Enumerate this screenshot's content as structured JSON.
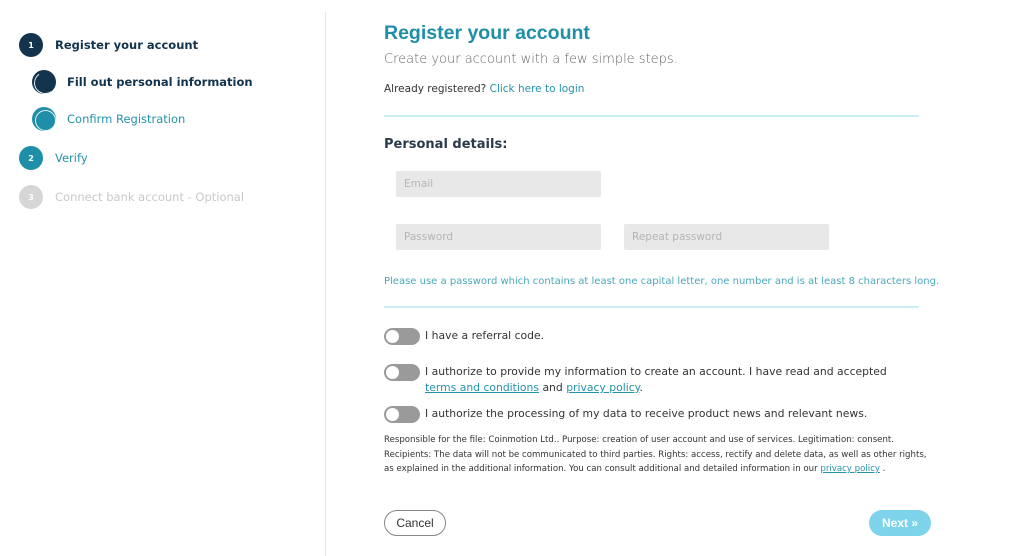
{
  "stepper": {
    "steps": [
      {
        "number": "1",
        "label": "Register your account",
        "state": "active"
      },
      {
        "number": "2",
        "label": "Verify",
        "state": "upcoming"
      },
      {
        "number": "3",
        "label": "Connect bank account - Optional",
        "state": "disabled"
      }
    ],
    "substeps": [
      {
        "label": "Fill out personal information",
        "state": "current"
      },
      {
        "label": "Confirm Registration",
        "state": "upcoming"
      }
    ]
  },
  "main": {
    "title": "Register your account",
    "subtitle": "Create your account with a few simple steps.",
    "already_registered": "Already registered?",
    "login_link": "Click here to login",
    "section_title": "Personal details:",
    "fields": {
      "email": {
        "placeholder": "Email",
        "value": ""
      },
      "password": {
        "placeholder": "Password",
        "value": ""
      },
      "repeat_password": {
        "placeholder": "Repeat password",
        "value": ""
      }
    },
    "password_hint": "Please use a password which contains at least one capital letter, one number and is at least 8 characters long.",
    "toggles": [
      {
        "label": "I have a referral code.",
        "checked": false
      },
      {
        "label_before": "I authorize to provide my information to create an account. I have read and accepted",
        "terms_link": "terms and conditions",
        "and": "and",
        "privacy_link": "privacy policy",
        "after": ".",
        "checked": false
      },
      {
        "label": "I authorize the processing of my data to receive product news and relevant news.",
        "checked": false
      }
    ],
    "legal_text": "Responsible for the file: Coinmotion Ltd.. Purpose: creation of user account and use of services. Legitimation: consent. Recipients: The data will not be communicated to third parties. Rights: access, rectify and delete data, as well as other rights, as explained in the additional information. You can consult additional and detailed information in our",
    "legal_link": "privacy policy",
    "legal_end": ".",
    "buttons": {
      "cancel": "Cancel",
      "next": "Next »"
    }
  },
  "colors": {
    "accent": "#1f8ea8",
    "dark": "#13344d",
    "next_button": "#7dd3ea",
    "divider": "#cceff3"
  }
}
